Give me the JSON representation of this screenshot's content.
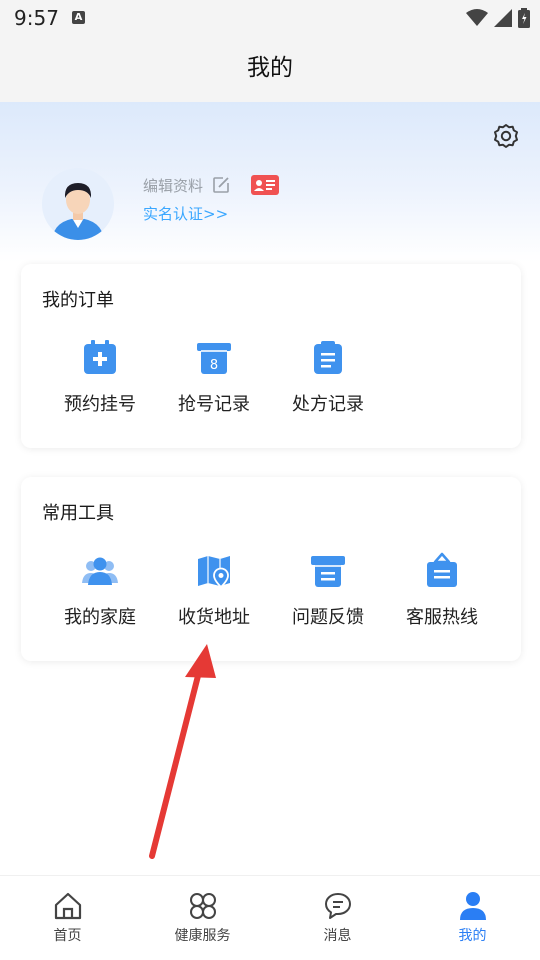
{
  "status_bar": {
    "time": "9:57",
    "notification_letter": "A"
  },
  "header": {
    "title": "我的"
  },
  "profile": {
    "edit_label": "编辑资料",
    "verify_link": "实名认证>>"
  },
  "orders": {
    "title": "我的订单",
    "items": [
      {
        "label": "预约挂号",
        "icon": "calendar-plus-icon"
      },
      {
        "label": "抢号记录",
        "icon": "ticket-icon"
      },
      {
        "label": "处方记录",
        "icon": "prescription-icon"
      }
    ]
  },
  "tools": {
    "title": "常用工具",
    "items": [
      {
        "label": "我的家庭",
        "icon": "family-icon"
      },
      {
        "label": "收货地址",
        "icon": "map-pin-icon"
      },
      {
        "label": "问题反馈",
        "icon": "feedback-icon"
      },
      {
        "label": "客服热线",
        "icon": "hotline-icon"
      }
    ]
  },
  "tab_bar": {
    "items": [
      {
        "label": "首页",
        "icon": "home-icon"
      },
      {
        "label": "健康服务",
        "icon": "grid-icon"
      },
      {
        "label": "消息",
        "icon": "message-icon"
      },
      {
        "label": "我的",
        "icon": "user-icon"
      }
    ],
    "active_index": 3
  },
  "colors": {
    "accent": "#2a7ef4",
    "link": "#3aa7ff",
    "icon_blue": "#3f92ee",
    "arrow_red": "#e53935",
    "badge_red": "#f05252"
  }
}
